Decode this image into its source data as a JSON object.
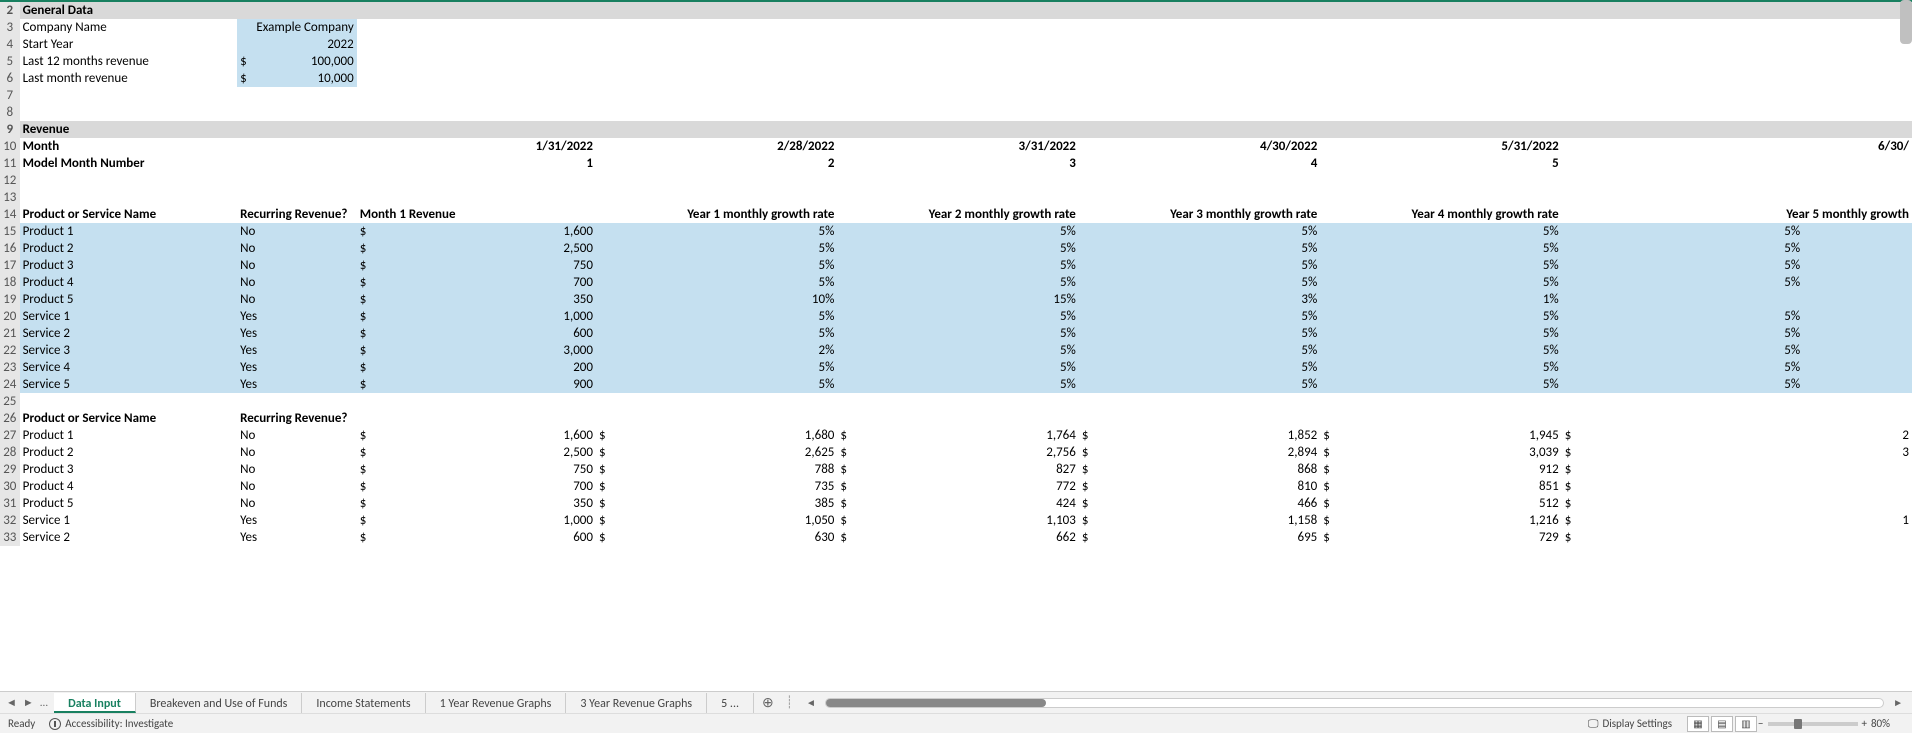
{
  "general": {
    "header": "General Data",
    "company_label": "Company Name",
    "company_value": "Example Company",
    "start_year_label": "Start Year",
    "start_year_value": "2022",
    "last12_label": "Last 12 months revenue",
    "last12_value": "100,000",
    "lastmonth_label": "Last month revenue",
    "lastmonth_value": "10,000"
  },
  "revenue": {
    "header": "Revenue",
    "month_label": "Month",
    "months": [
      "1/31/2022",
      "2/28/2022",
      "3/31/2022",
      "4/30/2022",
      "5/31/2022",
      "6/30/"
    ],
    "model_label": "Model Month Number",
    "model_nums": [
      "1",
      "2",
      "3",
      "4",
      "5",
      ""
    ]
  },
  "prod_headers": {
    "name": "Product or Service Name",
    "recurring": "Recurring Revenue?",
    "m1rev": "Month 1 Revenue",
    "y1": "Year 1 monthly growth rate",
    "y2": "Year 2 monthly growth rate",
    "y3": "Year 3 monthly growth rate",
    "y4": "Year 4 monthly growth rate",
    "y5": "Year 5 monthly growth"
  },
  "products": [
    {
      "name": "Product 1",
      "rec": "No",
      "m1": "1,600",
      "y1": "5%",
      "y2": "5%",
      "y3": "5%",
      "y4": "5%",
      "y5": "5%"
    },
    {
      "name": "Product 2",
      "rec": "No",
      "m1": "2,500",
      "y1": "5%",
      "y2": "5%",
      "y3": "5%",
      "y4": "5%",
      "y5": "5%"
    },
    {
      "name": "Product 3",
      "rec": "No",
      "m1": "750",
      "y1": "5%",
      "y2": "5%",
      "y3": "5%",
      "y4": "5%",
      "y5": "5%"
    },
    {
      "name": "Product 4",
      "rec": "No",
      "m1": "700",
      "y1": "5%",
      "y2": "5%",
      "y3": "5%",
      "y4": "5%",
      "y5": "5%"
    },
    {
      "name": "Product 5",
      "rec": "No",
      "m1": "350",
      "y1": "10%",
      "y2": "15%",
      "y3": "3%",
      "y4": "1%",
      "y5": ""
    },
    {
      "name": "Service 1",
      "rec": "Yes",
      "m1": "1,000",
      "y1": "5%",
      "y2": "5%",
      "y3": "5%",
      "y4": "5%",
      "y5": "5%"
    },
    {
      "name": "Service 2",
      "rec": "Yes",
      "m1": "600",
      "y1": "5%",
      "y2": "5%",
      "y3": "5%",
      "y4": "5%",
      "y5": "5%"
    },
    {
      "name": "Service 3",
      "rec": "Yes",
      "m1": "3,000",
      "y1": "2%",
      "y2": "5%",
      "y3": "5%",
      "y4": "5%",
      "y5": "5%"
    },
    {
      "name": "Service 4",
      "rec": "Yes",
      "m1": "200",
      "y1": "5%",
      "y2": "5%",
      "y3": "5%",
      "y4": "5%",
      "y5": "5%"
    },
    {
      "name": "Service 5",
      "rec": "Yes",
      "m1": "900",
      "y1": "5%",
      "y2": "5%",
      "y3": "5%",
      "y4": "5%",
      "y5": "5%"
    }
  ],
  "calc_header": {
    "name": "Product or Service Name",
    "recurring": "Recurring Revenue?"
  },
  "calc": [
    {
      "name": "Product 1",
      "rec": "No",
      "v": [
        "1,600",
        "1,680",
        "1,764",
        "1,852",
        "1,945",
        "2"
      ]
    },
    {
      "name": "Product 2",
      "rec": "No",
      "v": [
        "2,500",
        "2,625",
        "2,756",
        "2,894",
        "3,039",
        "3"
      ]
    },
    {
      "name": "Product 3",
      "rec": "No",
      "v": [
        "750",
        "788",
        "827",
        "868",
        "912",
        ""
      ]
    },
    {
      "name": "Product 4",
      "rec": "No",
      "v": [
        "700",
        "735",
        "772",
        "810",
        "851",
        ""
      ]
    },
    {
      "name": "Product 5",
      "rec": "No",
      "v": [
        "350",
        "385",
        "424",
        "466",
        "512",
        ""
      ]
    },
    {
      "name": "Service 1",
      "rec": "Yes",
      "v": [
        "1,000",
        "1,050",
        "1,103",
        "1,158",
        "1,216",
        "1"
      ]
    },
    {
      "name": "Service 2",
      "rec": "Yes",
      "v": [
        "600",
        "630",
        "662",
        "695",
        "729",
        ""
      ]
    }
  ],
  "tabs": {
    "active": "Data Input",
    "list": [
      "Data Input",
      "Breakeven and Use of Funds",
      "Income Statements",
      "1 Year Revenue Graphs",
      "3 Year Revenue Graphs",
      "5 ..."
    ],
    "more": "..."
  },
  "status": {
    "ready": "Ready",
    "accessibility": "Accessibility: Investigate",
    "display": "Display Settings",
    "zoom": "80%"
  }
}
